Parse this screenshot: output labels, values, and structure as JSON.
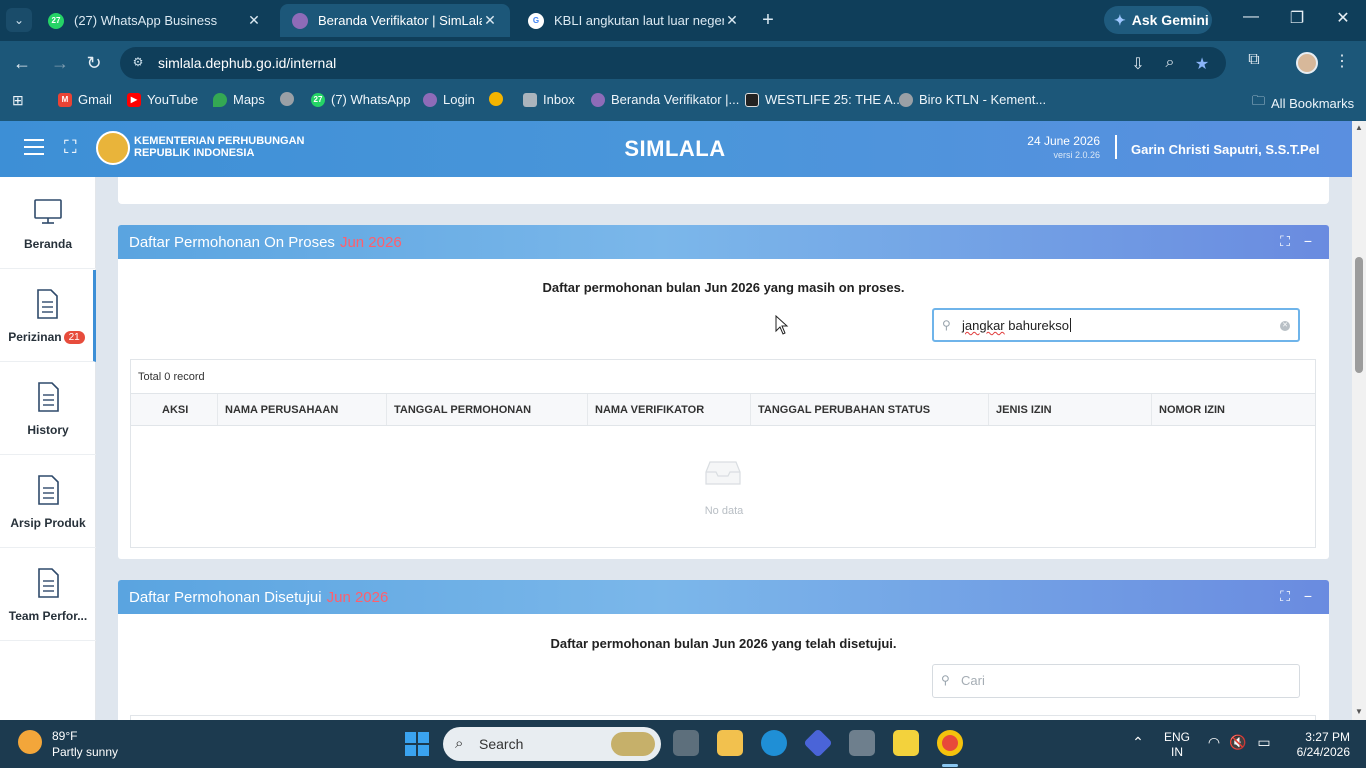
{
  "browser": {
    "tabs": [
      {
        "title": "(27) WhatsApp Business",
        "favicon_text": "27",
        "favicon_color": "#25d366"
      },
      {
        "title": "Beranda Verifikator | SimLala",
        "favicon_text": "",
        "favicon_color": "#8e6bb8",
        "active": true
      },
      {
        "title": "KBLI angkutan laut luar negeri u",
        "favicon_text": "G",
        "favicon_color": "#ffffff"
      }
    ],
    "ask_gemini": "Ask Gemini",
    "url": "simlala.dephub.go.id/internal",
    "bookmarks": [
      {
        "label": "Gmail",
        "color": "#ea4335"
      },
      {
        "label": "YouTube",
        "color": "#ff0000"
      },
      {
        "label": "Maps",
        "color": "#34a853"
      },
      {
        "label": "",
        "color": "#9aa0a6"
      },
      {
        "label": "(7) WhatsApp",
        "color": "#25d366"
      },
      {
        "label": "Login",
        "color": "#8e6bb8"
      },
      {
        "label": "",
        "color": "#f4b400"
      },
      {
        "label": "Inbox",
        "color": "#aab4bd"
      },
      {
        "label": "Beranda Verifikator |...",
        "color": "#8e6bb8"
      },
      {
        "label": "WESTLIFE 25: THE A...",
        "color": "#222222"
      },
      {
        "label": "Biro KTLN - Kement...",
        "color": "#9aa0a6"
      }
    ],
    "all_bookmarks": "All Bookmarks"
  },
  "header": {
    "org_line1": "KEMENTERIAN PERHUBUNGAN",
    "org_line2": "REPUBLIK INDONESIA",
    "app_title": "SIMLALA",
    "date": "24 June 2026",
    "version": "versi 2.0.26",
    "user": "Garin Christi Saputri, S.S.T.Pel"
  },
  "sidebar": {
    "items": [
      {
        "label": "Beranda",
        "icon": "monitor-icon"
      },
      {
        "label": "Perizinan",
        "icon": "document-icon",
        "badge": "21",
        "active": true
      },
      {
        "label": "History",
        "icon": "document-icon"
      },
      {
        "label": "Arsip Produk",
        "icon": "document-icon"
      },
      {
        "label": "Team Perfor...",
        "icon": "document-icon"
      }
    ]
  },
  "onproses": {
    "title": "Daftar Permohonan On Proses",
    "month": "Jun 2026",
    "subtitle": "Daftar permohonan bulan Jun 2026 yang masih on proses.",
    "search_value_word1": "jangkar",
    "search_value_word2": " bahurekso",
    "total": "Total 0 record",
    "columns": [
      "AKSI",
      "NAMA PERUSAHAAN",
      "TANGGAL PERMOHONAN",
      "NAMA VERIFIKATOR",
      "TANGGAL PERUBAHAN STATUS",
      "JENIS IZIN",
      "NOMOR IZIN"
    ],
    "empty_text": "No data"
  },
  "disetujui": {
    "title": "Daftar Permohonan Disetujui",
    "month": "Jun 2026",
    "subtitle": "Daftar permohonan bulan Jun 2026 yang telah disetujui.",
    "search_placeholder": "Cari"
  },
  "taskbar": {
    "temp": "89°F",
    "weather": "Partly sunny",
    "search_label": "Search",
    "lang_line1": "ENG",
    "lang_line2": "IN",
    "time": "3:27 PM",
    "date": "6/24/2026"
  }
}
